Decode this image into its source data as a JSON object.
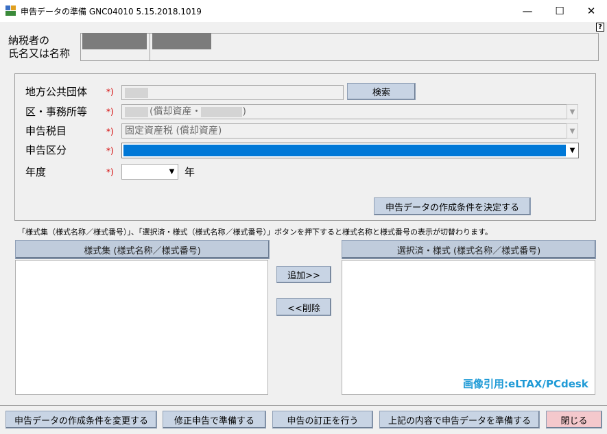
{
  "window": {
    "title": "申告データの準備 GNC04010  5.15.2018.1019",
    "minimize": "—",
    "maximize": "☐",
    "close": "✕",
    "help": "?"
  },
  "taxpayer": {
    "label_line1": "納税者の",
    "label_line2": "氏名又は名称"
  },
  "form": {
    "local_gov_label": "地方公共団体",
    "ward_label": "区・事務所等",
    "tax_item_label": "申告税目",
    "category_label": "申告区分",
    "year_label": "年度",
    "required_mark": "*)",
    "search_button": "検索",
    "ward_value_mid": "(償却資産・",
    "ward_value_end": ")",
    "tax_item_value": "固定資産税 (償却資産)",
    "category_value": "",
    "year_value": "",
    "year_suffix": "年",
    "decide_button": "申告データの作成条件を決定する"
  },
  "note": "「様式集（様式名称／様式番号）」、「選択済・様式（様式名称／様式番号）」ボタンを押下すると様式名称と様式番号の表示が切替わります。",
  "lists": {
    "left_header": "様式集 (様式名称／様式番号)",
    "right_header": "選択済・様式 (様式名称／様式番号)",
    "add_button": "追加>>",
    "remove_button": "<<削除"
  },
  "watermark": "画像引用:eLTAX/PCdesk",
  "footer": {
    "change_button": "申告データの作成条件を変更する",
    "amend_button": "修正申告で準備する",
    "correct_button": "申告の訂正を行う",
    "prepare_button": "上記の内容で申告データを準備する",
    "close_button": "閉じる"
  },
  "icons": {
    "dropdown": "▼",
    "app": "app-window-icon"
  },
  "colors": {
    "selection": "#0078d7",
    "required": "#d40000",
    "button": "#c8d4e4",
    "watermark": "#1e9ad6"
  }
}
